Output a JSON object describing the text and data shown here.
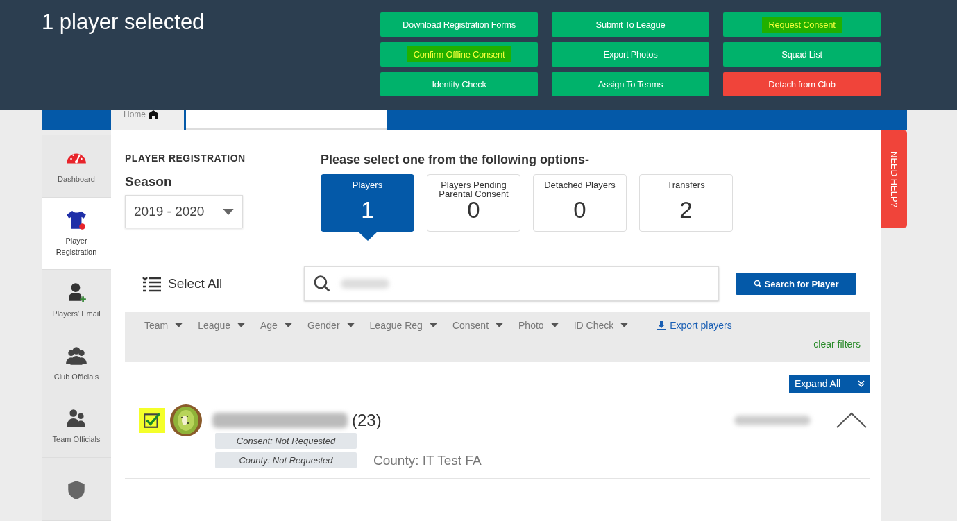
{
  "selection_bar": {
    "title": "1 player selected",
    "actions": [
      {
        "label": "Download Registration Forms",
        "kind": "action",
        "highlighted": false
      },
      {
        "label": "Submit To League",
        "kind": "action",
        "highlighted": false
      },
      {
        "label": "Request Consent",
        "kind": "action",
        "highlighted": true
      },
      {
        "label": "Confirm Offline Consent",
        "kind": "action",
        "highlighted": true
      },
      {
        "label": "Export Photos",
        "kind": "action",
        "highlighted": false
      },
      {
        "label": "Squad List",
        "kind": "action",
        "highlighted": false
      },
      {
        "label": "Identity Check",
        "kind": "action",
        "highlighted": false
      },
      {
        "label": "Assign To Teams",
        "kind": "action",
        "highlighted": false
      },
      {
        "label": "Detach from Club",
        "kind": "danger",
        "highlighted": false
      }
    ]
  },
  "header": {
    "home_tab": "Home"
  },
  "sidebar": {
    "items": [
      {
        "label": "Dashboard",
        "selected": false
      },
      {
        "label": "Player Registration",
        "selected": true
      },
      {
        "label": "Players' Email",
        "selected": false
      },
      {
        "label": "Club Officials",
        "selected": false
      },
      {
        "label": "Team Officials",
        "selected": false
      },
      {
        "selected": false
      }
    ]
  },
  "section_title": "PLAYER REGISTRATION",
  "season": {
    "label": "Season",
    "value": "2019 - 2020"
  },
  "options": {
    "prompt": "Please select one from the following options-",
    "cards": [
      {
        "label": "Players",
        "count": "1",
        "selected": true
      },
      {
        "label": "Players Pending Parental Consent",
        "count": "0",
        "selected": false
      },
      {
        "label": "Detached Players",
        "count": "0",
        "selected": false
      },
      {
        "label": "Transfers",
        "count": "2",
        "selected": false
      }
    ]
  },
  "select_all": "Select All",
  "search_button": "Search for Player",
  "filters": [
    "Team",
    "League",
    "Age",
    "Gender",
    "League Reg",
    "Consent",
    "Photo",
    "ID Check"
  ],
  "export_link": "Export players",
  "clear_filters": "clear filters",
  "expand_all": "Expand All",
  "need_help": "NEED HELP?",
  "players": [
    {
      "checked": true,
      "highlighted": true,
      "age": "(23)",
      "expanded": true,
      "tags": [
        "Consent: Not Requested",
        "County: Not Requested"
      ],
      "county": "County: IT Test FA"
    }
  ]
}
